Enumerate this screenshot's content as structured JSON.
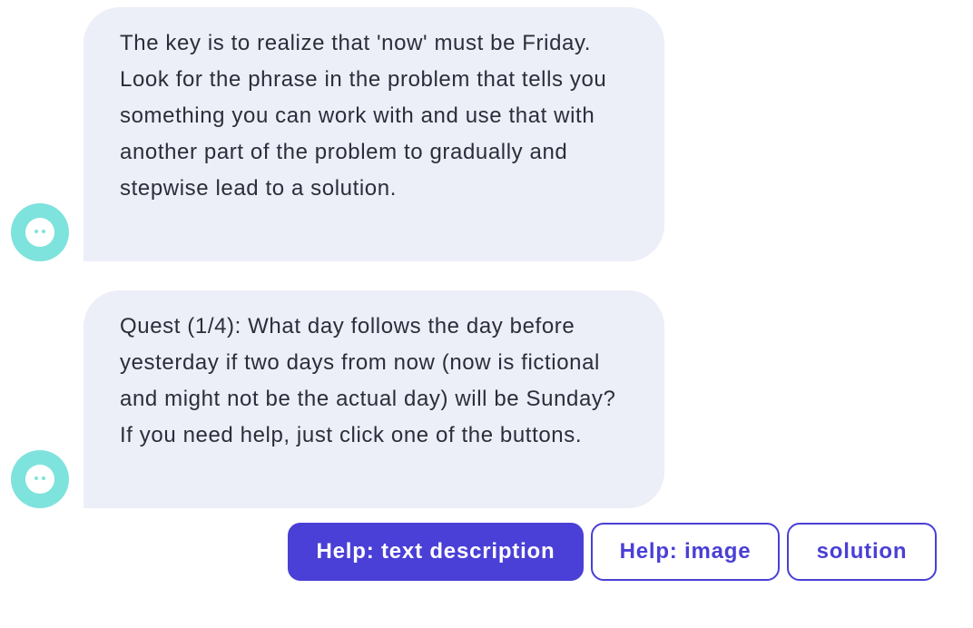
{
  "messages": [
    {
      "sender_avatar": "robot-face-icon",
      "text": "The key is to realize that 'now' must be Friday. Look for the phrase in the problem that tells you something you can work with and use that with another part of the problem to gradually and stepwise lead to a solution."
    },
    {
      "sender_avatar": "robot-face-icon",
      "text": "Quest (1/4): What day follows the day before yesterday if two days from now (now is fictional and might not be the actual day) will be Sunday? If you need help, just click one of the buttons."
    }
  ],
  "actions": {
    "help_text_label": "Help: text description",
    "help_image_label": "Help: image",
    "solution_label": "solution"
  },
  "colors": {
    "accent": "#4a3fd6",
    "bubble_bg": "#eceef8",
    "avatar": "#7ee3dc",
    "text": "#2b2e3a"
  }
}
